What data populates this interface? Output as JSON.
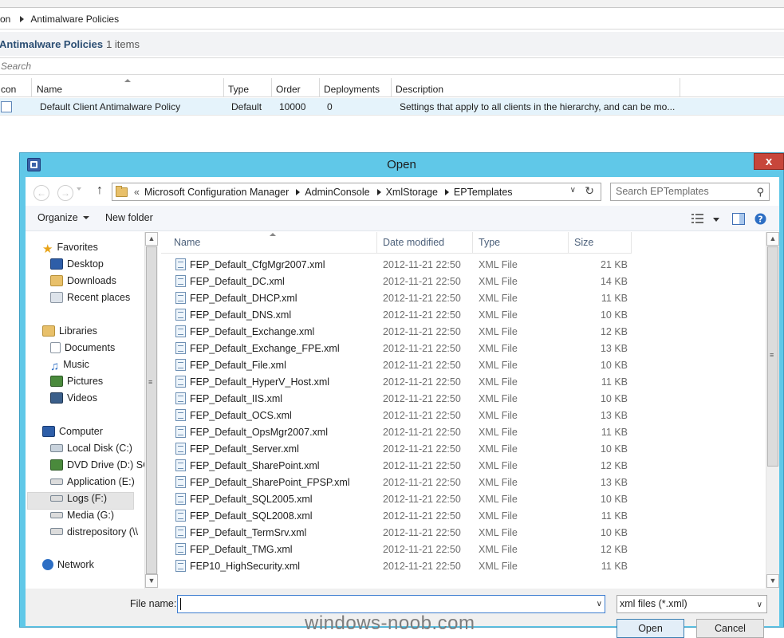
{
  "console": {
    "breadcrumb": [
      "on",
      "Antimalware Policies"
    ],
    "header_title": "Antimalware Policies",
    "header_count": "1 items",
    "search_placeholder": "Search",
    "columns": [
      "con",
      "Name",
      "Type",
      "Order",
      "Deployments",
      "Description"
    ],
    "row": {
      "name": "Default Client Antimalware Policy",
      "type": "Default",
      "order": "10000",
      "deployments": "0",
      "description": "Settings that apply to all clients in the hierarchy, and can be mo..."
    }
  },
  "dialog": {
    "title": "Open",
    "close_glyph": "x",
    "address": [
      "Microsoft Configuration Manager",
      "AdminConsole",
      "XmlStorage",
      "EPTemplates"
    ],
    "address_overflow": "«",
    "search_placeholder": "Search EPTemplates",
    "toolbar": {
      "organize": "Organize",
      "new_folder": "New folder"
    },
    "nav": {
      "favorites": "Favorites",
      "desktop": "Desktop",
      "downloads": "Downloads",
      "recent": "Recent places",
      "libraries": "Libraries",
      "documents": "Documents",
      "music": "Music",
      "pictures": "Pictures",
      "videos": "Videos",
      "computer": "Computer",
      "local_disk": "Local Disk (C:)",
      "dvd": "DVD Drive (D:) SC",
      "application": "Application (E:)",
      "logs": "Logs (F:)",
      "media": "Media (G:)",
      "distrepo": "distrepository (\\\\",
      "network": "Network"
    },
    "columns": {
      "name": "Name",
      "date": "Date modified",
      "type": "Type",
      "size": "Size"
    },
    "files": [
      {
        "name": "FEP_Default_CfgMgr2007.xml",
        "date": "2012-11-21 22:50",
        "type": "XML File",
        "size": "21 KB"
      },
      {
        "name": "FEP_Default_DC.xml",
        "date": "2012-11-21 22:50",
        "type": "XML File",
        "size": "14 KB"
      },
      {
        "name": "FEP_Default_DHCP.xml",
        "date": "2012-11-21 22:50",
        "type": "XML File",
        "size": "11 KB"
      },
      {
        "name": "FEP_Default_DNS.xml",
        "date": "2012-11-21 22:50",
        "type": "XML File",
        "size": "10 KB"
      },
      {
        "name": "FEP_Default_Exchange.xml",
        "date": "2012-11-21 22:50",
        "type": "XML File",
        "size": "12 KB"
      },
      {
        "name": "FEP_Default_Exchange_FPE.xml",
        "date": "2012-11-21 22:50",
        "type": "XML File",
        "size": "13 KB"
      },
      {
        "name": "FEP_Default_File.xml",
        "date": "2012-11-21 22:50",
        "type": "XML File",
        "size": "10 KB"
      },
      {
        "name": "FEP_Default_HyperV_Host.xml",
        "date": "2012-11-21 22:50",
        "type": "XML File",
        "size": "11 KB"
      },
      {
        "name": "FEP_Default_IIS.xml",
        "date": "2012-11-21 22:50",
        "type": "XML File",
        "size": "10 KB"
      },
      {
        "name": "FEP_Default_OCS.xml",
        "date": "2012-11-21 22:50",
        "type": "XML File",
        "size": "13 KB"
      },
      {
        "name": "FEP_Default_OpsMgr2007.xml",
        "date": "2012-11-21 22:50",
        "type": "XML File",
        "size": "11 KB"
      },
      {
        "name": "FEP_Default_Server.xml",
        "date": "2012-11-21 22:50",
        "type": "XML File",
        "size": "10 KB"
      },
      {
        "name": "FEP_Default_SharePoint.xml",
        "date": "2012-11-21 22:50",
        "type": "XML File",
        "size": "12 KB"
      },
      {
        "name": "FEP_Default_SharePoint_FPSP.xml",
        "date": "2012-11-21 22:50",
        "type": "XML File",
        "size": "13 KB"
      },
      {
        "name": "FEP_Default_SQL2005.xml",
        "date": "2012-11-21 22:50",
        "type": "XML File",
        "size": "10 KB"
      },
      {
        "name": "FEP_Default_SQL2008.xml",
        "date": "2012-11-21 22:50",
        "type": "XML File",
        "size": "11 KB"
      },
      {
        "name": "FEP_Default_TermSrv.xml",
        "date": "2012-11-21 22:50",
        "type": "XML File",
        "size": "10 KB"
      },
      {
        "name": "FEP_Default_TMG.xml",
        "date": "2012-11-21 22:50",
        "type": "XML File",
        "size": "12 KB"
      },
      {
        "name": "FEP10_HighSecurity.xml",
        "date": "2012-11-21 22:50",
        "type": "XML File",
        "size": "11 KB"
      }
    ],
    "file_name_label": "File name:",
    "file_name_value": "",
    "file_type": "xml files (*.xml)",
    "open_button": "Open",
    "cancel_button": "Cancel"
  },
  "watermark": "windows-noob.com",
  "colors": {
    "dialog_frame": "#60c8e8",
    "close_button": "#c7463b",
    "console_header": "#2b4e73"
  }
}
